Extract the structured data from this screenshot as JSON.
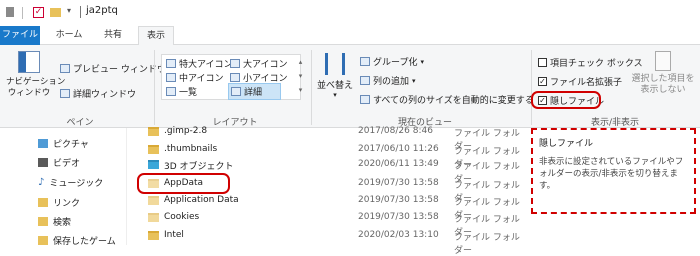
{
  "window": {
    "title": "ja2ptq"
  },
  "tabs": [
    "ファイル",
    "ホーム",
    "共有",
    "表示"
  ],
  "ribbon": {
    "pane": {
      "nav_pane": "ナビゲーション\nウィンドウ",
      "preview": "プレビュー ウィンドウ",
      "details": "詳細ウィンドウ",
      "label": "ペイン"
    },
    "layout": {
      "xl": "特大アイコン",
      "large": "大アイコン",
      "medium": "中アイコン",
      "small": "小アイコン",
      "list": "一覧",
      "detail": "詳細",
      "label": "レイアウト"
    },
    "view": {
      "sort": "並べ替え",
      "group": "グループ化",
      "add_col": "列の追加",
      "fit": "すべての列のサイズを自動的に変更する",
      "label": "現在のビュー"
    },
    "show": {
      "checkbox": "項目チェック ボックス",
      "ext": "ファイル名拡張子",
      "hidden": "隠しファイル",
      "hide_sel": "選択した項目を\n表示しない",
      "label": "表示/非表示"
    }
  },
  "nav": [
    {
      "label": "ピクチャ",
      "icon": "pictures-icon"
    },
    {
      "label": "ビデオ",
      "icon": "video-icon"
    },
    {
      "label": "ミュージック",
      "icon": "music-icon"
    },
    {
      "label": "リンク",
      "icon": "link-icon"
    },
    {
      "label": "検索",
      "icon": "search-icon"
    },
    {
      "label": "保存したゲーム",
      "icon": "games-icon"
    }
  ],
  "files": [
    {
      "name": ".gimp-2.8",
      "date": "2017/08/26 8:46",
      "type": "ファイル フォルダー"
    },
    {
      "name": ".thumbnails",
      "date": "2017/06/10 11:26",
      "type": "ファイル フォルダー"
    },
    {
      "name": "3D オブジェクト",
      "date": "2020/06/11 13:49",
      "type": "ファイル フォルダー"
    },
    {
      "name": "AppData",
      "date": "2019/07/30 13:58",
      "type": "ファイル フォルダー"
    },
    {
      "name": "Application Data",
      "date": "2019/07/30 13:58",
      "type": "ファイル フォルダー"
    },
    {
      "name": "Cookies",
      "date": "2019/07/30 13:58",
      "type": "ファイル フォルダー"
    },
    {
      "name": "Intel",
      "date": "2020/02/03 13:10",
      "type": "ファイル フォルダー"
    }
  ],
  "tooltip": {
    "title": "隠しファイル",
    "body": "非表示に設定されているファイルやフォルダーの表示/非表示を切り替えます。"
  }
}
